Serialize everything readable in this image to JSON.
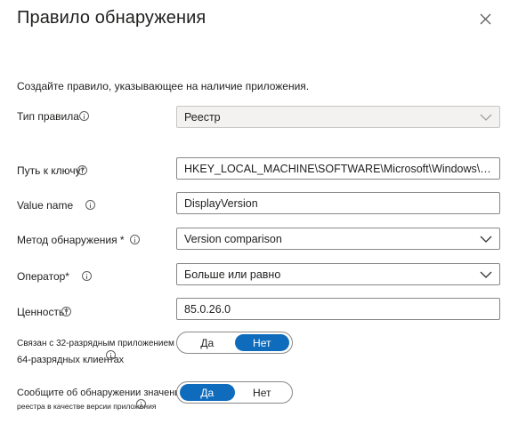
{
  "dialog": {
    "title": "Правило обнаружения",
    "description": "Создайте правило, указывающее на наличие приложения."
  },
  "fields": {
    "rule_type": {
      "label": "Тип правила",
      "value": "Реестр"
    },
    "key_path": {
      "label": "Путь к ключу*",
      "value": "HKEY_LOCAL_MACHINE\\SOFTWARE\\Microsoft\\Windows\\C..."
    },
    "value_name": {
      "label": "Value name",
      "value": "DisplayVersion"
    },
    "detection_method": {
      "label": "Метод обнаружения *",
      "value": "Version comparison"
    },
    "operator": {
      "label": "Оператор*",
      "value": "Больше или равно"
    },
    "value": {
      "label": "Ценность*",
      "value": "85.0.26.0"
    }
  },
  "toggles": {
    "bit32": {
      "label_line1": "Связан с 32-разрядным приложением на",
      "label_line2": "64-разрядных клиентах",
      "option_yes": "Да",
      "option_no": "Нет",
      "selected": "Нет"
    },
    "report_version": {
      "label_line1": "Сообщите об обнаружении значения",
      "label_line2": "реестра в качестве версии приложения",
      "option_yes": "Да",
      "option_no": "Нет",
      "selected": "Да"
    }
  },
  "icons": {
    "close": "close-icon",
    "info": "info-icon",
    "chevron": "chevron-down-icon"
  },
  "colors": {
    "accent": "#0f6cbd",
    "border": "#8a8886",
    "disabled_bg": "#f3f2f1"
  }
}
